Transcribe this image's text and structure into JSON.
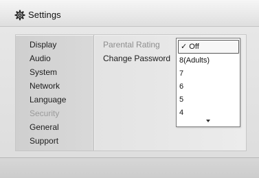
{
  "header": {
    "title": "Settings",
    "icon": "gear-icon"
  },
  "sidebar": {
    "items": [
      {
        "label": "Display"
      },
      {
        "label": "Audio"
      },
      {
        "label": "System"
      },
      {
        "label": "Network"
      },
      {
        "label": "Language"
      },
      {
        "label": "Security",
        "selected": true
      },
      {
        "label": "General"
      },
      {
        "label": "Support"
      }
    ]
  },
  "security_menu": {
    "items": [
      {
        "label": "Parental Rating"
      },
      {
        "label": "Change Password"
      }
    ]
  },
  "rating_dropdown": {
    "selected_mark": "✓",
    "options": [
      {
        "label": "Off",
        "selected": true
      },
      {
        "label": "8(Adults)"
      },
      {
        "label": "7"
      },
      {
        "label": "6"
      },
      {
        "label": "5"
      },
      {
        "label": "4"
      }
    ]
  }
}
